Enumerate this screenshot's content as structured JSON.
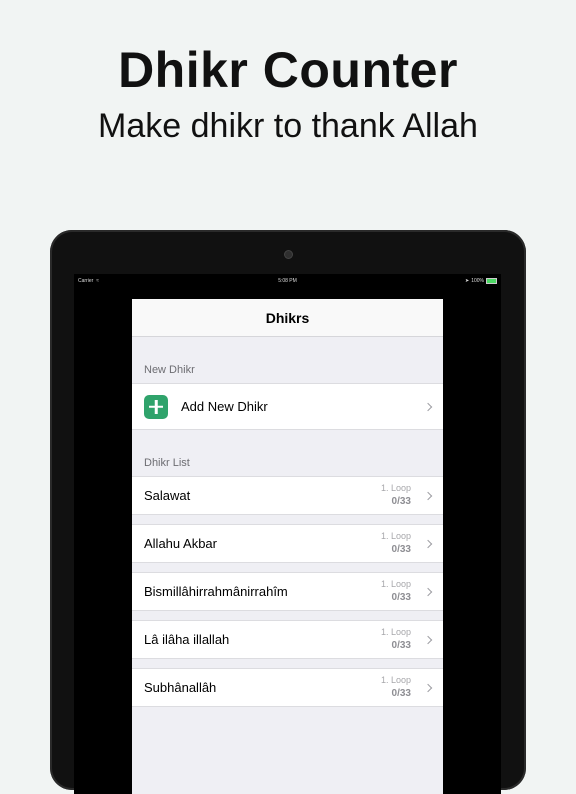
{
  "headline": {
    "title": "Dhikr Counter",
    "subtitle": "Make dhikr to thank Allah"
  },
  "statusbar": {
    "carrier": "Carrier",
    "time": "5:08 PM",
    "battery": "100%",
    "icons": [
      "wifi-icon",
      "location-icon",
      "battery-icon"
    ]
  },
  "nav": {
    "title": "Dhikrs"
  },
  "new_section": {
    "header": "New Dhikr",
    "add_label": "Add New Dhikr"
  },
  "list_section": {
    "header": "Dhikr List",
    "items": [
      {
        "name": "Salawat",
        "loop": "1. Loop",
        "count": "0/33"
      },
      {
        "name": "Allahu Akbar",
        "loop": "1. Loop",
        "count": "0/33"
      },
      {
        "name": "Bismillâhirrahmânirrahîm",
        "loop": "1. Loop",
        "count": "0/33"
      },
      {
        "name": "Lâ ilâha illallah",
        "loop": "1. Loop",
        "count": "0/33"
      },
      {
        "name": "Subhânallâh",
        "loop": "1. Loop",
        "count": "0/33"
      }
    ]
  },
  "colors": {
    "background": "#f1f4f3",
    "accent_green": "#2fa36b",
    "device": "#111111"
  }
}
